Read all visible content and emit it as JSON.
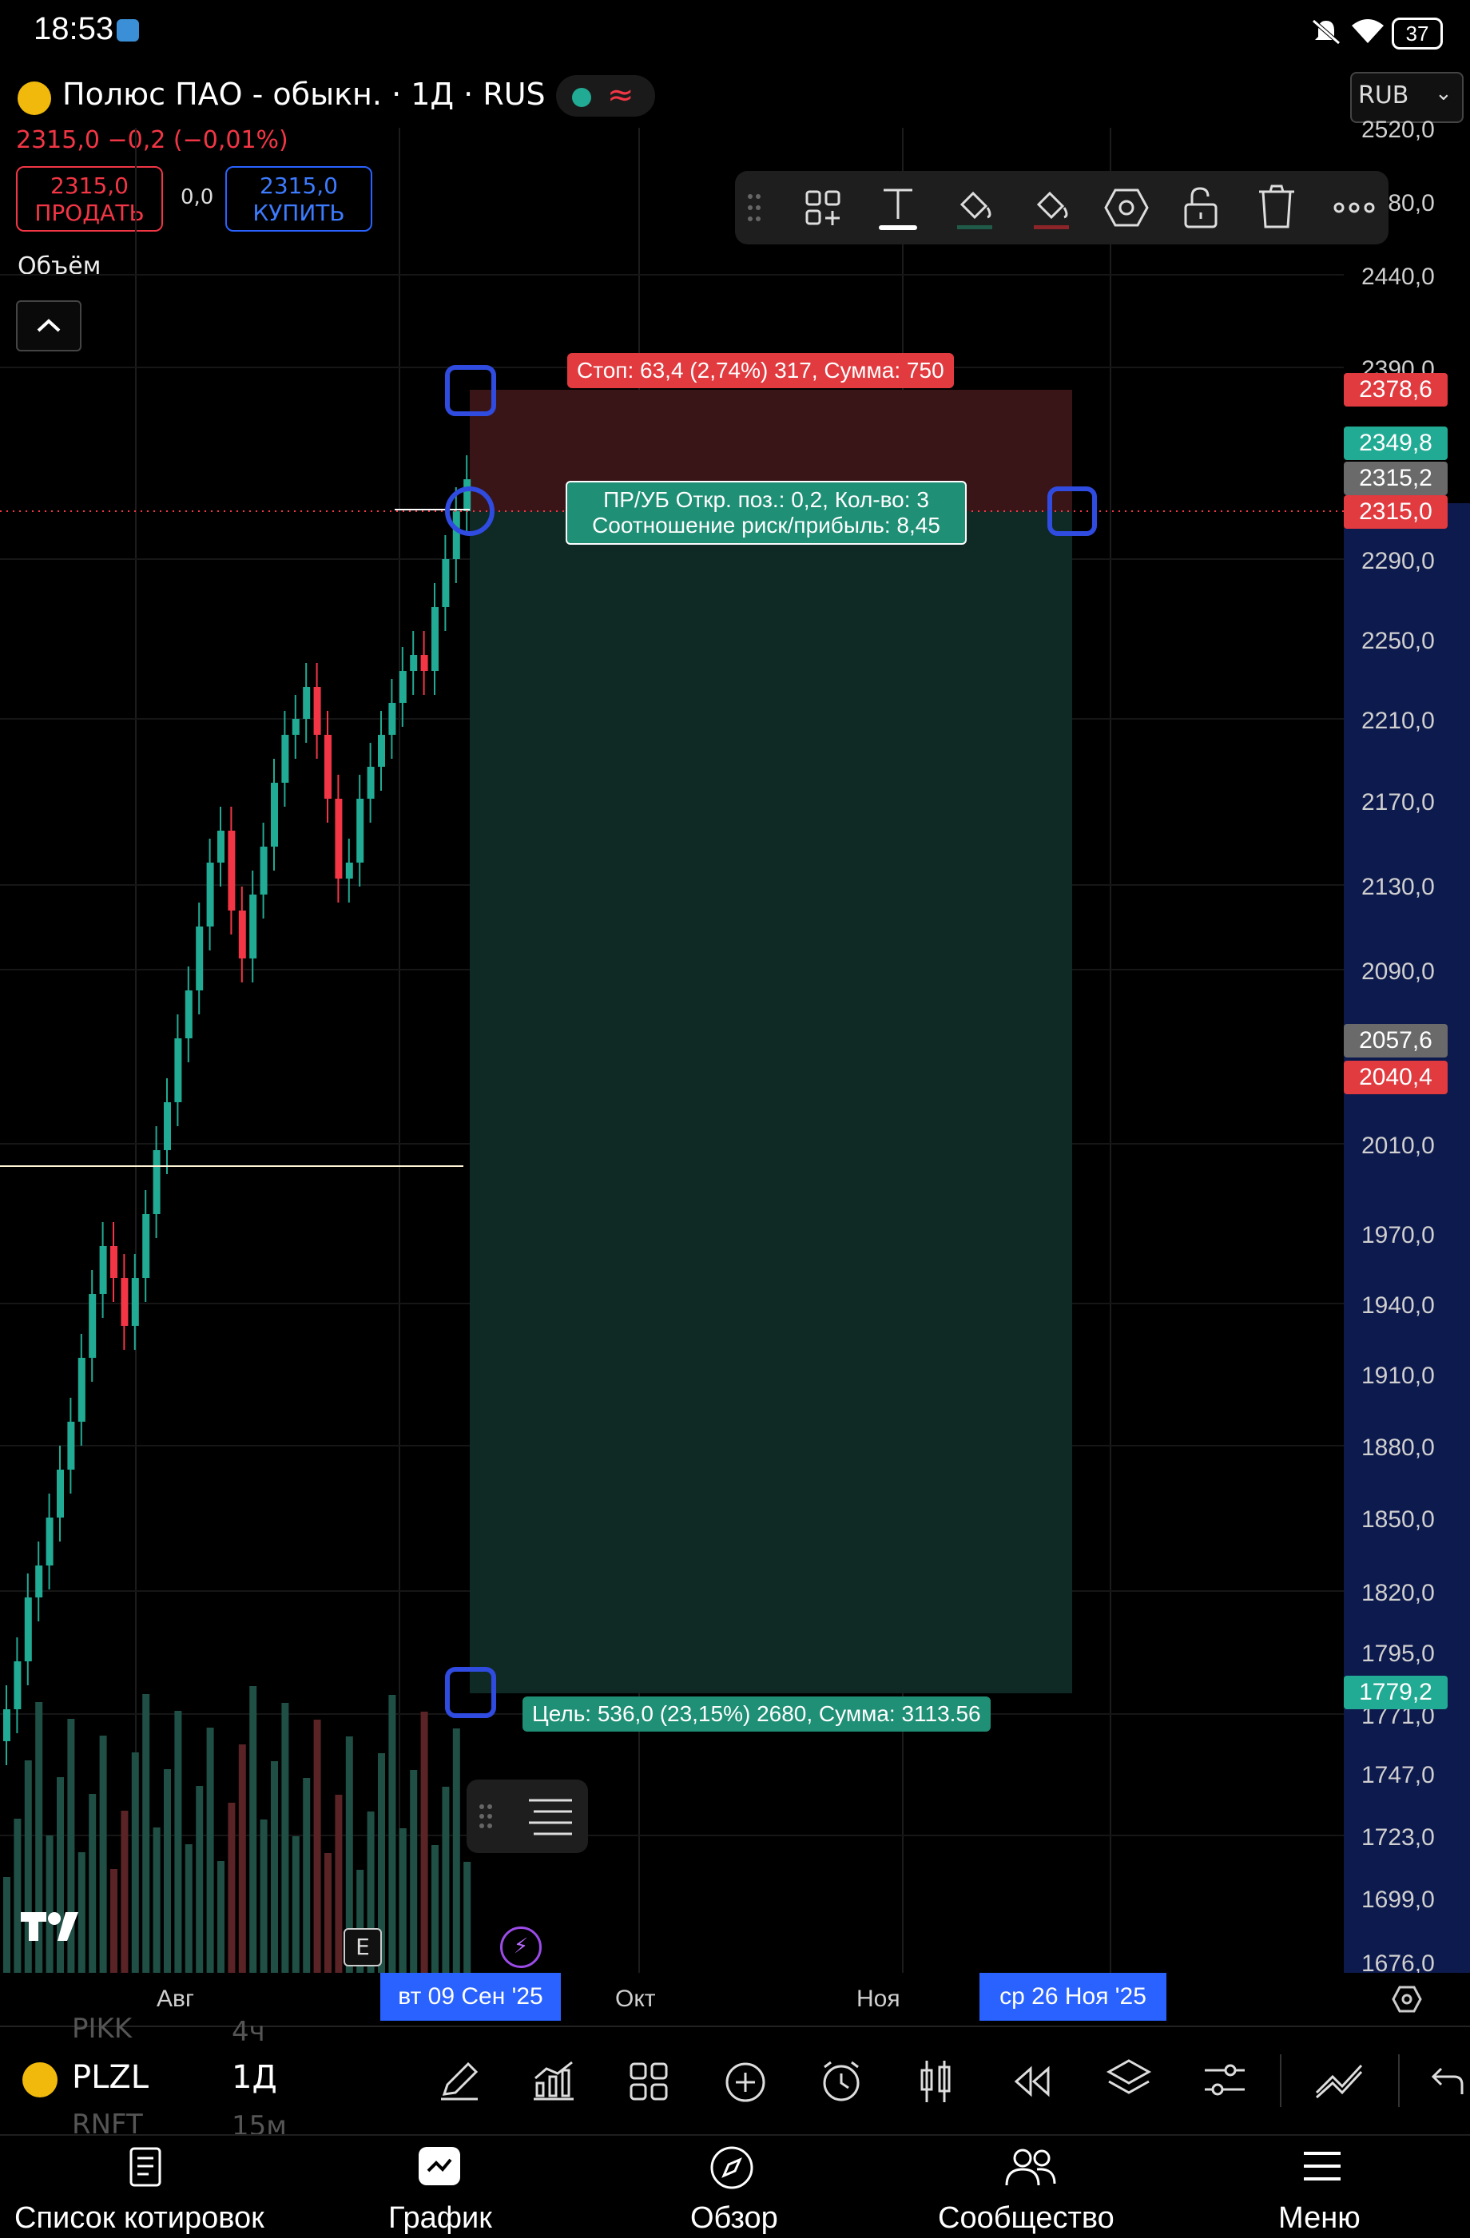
{
  "status_bar": {
    "time": "18:53",
    "battery": "37"
  },
  "symbol": {
    "title": "Полюс ПАО - обыкн. · 1Д · RUS",
    "currency": "RUB",
    "change_line": "2315,0  −0,2 (−0,01%)",
    "sell": {
      "price": "2315,0",
      "label": "ПРОДАТЬ"
    },
    "buy": {
      "price": "2315,0",
      "label": "КУПИТЬ"
    },
    "spread": "0,0"
  },
  "indicator": {
    "volume_label": "Объём"
  },
  "price_scale": {
    "labels": [
      "2520,0",
      "2480,0",
      "2440,0",
      "2390,0",
      "2290,0",
      "2250,0",
      "2210,0",
      "2170,0",
      "2130,0",
      "2090,0",
      "2010,0",
      "1970,0",
      "1940,0",
      "1910,0",
      "1880,0",
      "1850,0",
      "1820,0",
      "1795,0",
      "1771,0",
      "1747,0",
      "1723,0",
      "1699,0",
      "1676,0"
    ],
    "tags": {
      "stop": "2378,6",
      "high": "2349,8",
      "last_gray": "2315,2",
      "current": "2315,0",
      "gray2": "2057,6",
      "red2": "2040,4",
      "target": "1779,2"
    }
  },
  "position_tool": {
    "stop_label": "Стоп: 63,4 (2,74%) 317, Сумма: 750",
    "info_line1": "ПР/УБ Откр. поз.: 0,2, Кол-во: 3",
    "info_line2": "Соотношение риск/прибыль: 8,45",
    "target_label": "Цель: 536,0 (23,15%) 2680, Сумма: 3113.56"
  },
  "time_scale": {
    "labels": [
      "Авг",
      "Окт",
      "Ноя"
    ],
    "badge_start": "вт 09 Сен '25",
    "badge_end": "ср 26 Ноя '25"
  },
  "bottom_toolbar": {
    "symbol": "PLZL",
    "timeframe": "1Д",
    "ghost_rows": [
      "PIKK",
      "4ч",
      "RNFT",
      "15м"
    ]
  },
  "nav": {
    "watchlist": "Список котировок",
    "chart": "График",
    "overview": "Обзор",
    "community": "Сообщество",
    "menu": "Меню"
  },
  "colors": {
    "up": "#22ab94",
    "down": "#f23645",
    "accent": "#2962ff",
    "stop_zone": "#3a1518",
    "target_zone": "#0f2a24"
  },
  "icons": {
    "draw_toolbar": [
      "drag-handle-icon",
      "add-object-icon",
      "text-icon",
      "fill-bucket-icon",
      "line-color-icon",
      "settings-hex-icon",
      "unlock-icon",
      "trash-icon",
      "more-icon"
    ],
    "bottom_tools": [
      "pencil-icon",
      "indicators-icon",
      "templates-icon",
      "add-icon",
      "alert-clock-icon",
      "candles-icon",
      "replay-icon",
      "layers-icon",
      "settings-sliders-icon",
      "compare-icon",
      "undo-icon"
    ]
  }
}
